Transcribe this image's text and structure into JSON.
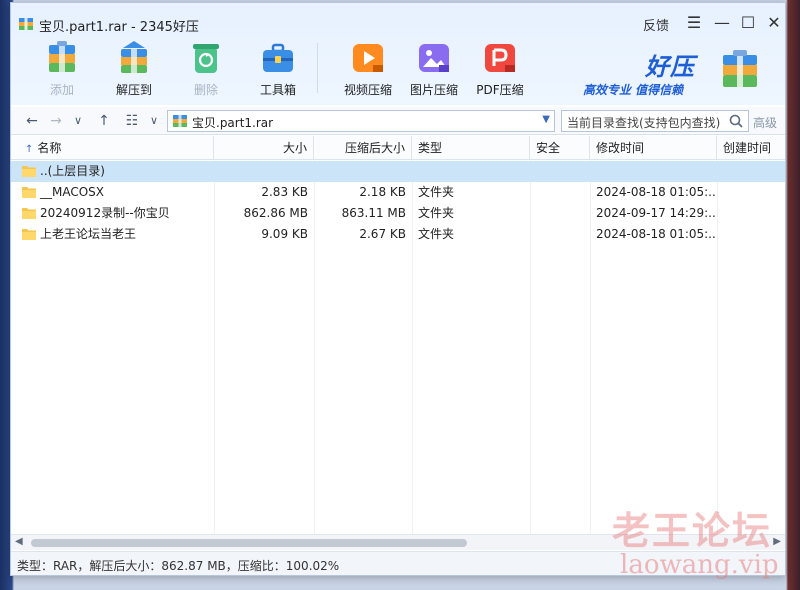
{
  "window": {
    "title": "宝贝.part1.rar - 2345好压",
    "feedback": "反馈",
    "controls": {
      "menu": "☰",
      "minimize": "—",
      "maximize": "☐",
      "close": "✕"
    }
  },
  "toolbar": {
    "items": [
      {
        "label": "添加",
        "enabled": false
      },
      {
        "label": "解压到",
        "enabled": true
      },
      {
        "label": "删除",
        "enabled": false
      },
      {
        "label": "工具箱",
        "enabled": true
      },
      {
        "label": "视频压缩",
        "enabled": true
      },
      {
        "label": "图片压缩",
        "enabled": true
      },
      {
        "label": "PDF压缩",
        "enabled": true
      }
    ]
  },
  "brand": {
    "name": "好压",
    "slogan": "高效专业  值得信赖"
  },
  "nav": {
    "back": "←",
    "forward": "→",
    "dropdown": "∨",
    "up": "↑",
    "view": "☷",
    "view_dropdown": "∨",
    "path": "宝贝.part1.rar",
    "search_placeholder": "当前目录查找(支持包内查找)",
    "advanced": "高级"
  },
  "table": {
    "columns": [
      "名称",
      "大小",
      "压缩后大小",
      "类型",
      "安全",
      "修改时间",
      "创建时间"
    ],
    "sort_indicator": "↑",
    "rows": [
      {
        "name": "..(上层目录)",
        "size": "",
        "packed": "",
        "type": "",
        "security": "",
        "modified": "",
        "created": ""
      },
      {
        "name": "__MACOSX",
        "size": "2.83 KB",
        "packed": "2.18 KB",
        "type": "文件夹",
        "security": "",
        "modified": "2024-08-18 01:05:...",
        "created": ""
      },
      {
        "name": "20240912录制--你宝贝",
        "size": "862.86 MB",
        "packed": "863.11 MB",
        "type": "文件夹",
        "security": "",
        "modified": "2024-09-17 14:29:...",
        "created": ""
      },
      {
        "name": "上老王论坛当老王",
        "size": "9.09 KB",
        "packed": "2.67 KB",
        "type": "文件夹",
        "security": "",
        "modified": "2024-08-18 01:05:...",
        "created": ""
      }
    ]
  },
  "status": {
    "text": "类型：RAR，解压后大小：862.87 MB，压缩比：100.02%"
  },
  "watermark": {
    "line1": "老王论坛",
    "line2": "laowang.vip"
  },
  "colors": {
    "accent": "#1f5fd6",
    "selected_row": "#cce4f7",
    "titlebar": "#e7f1ff"
  }
}
